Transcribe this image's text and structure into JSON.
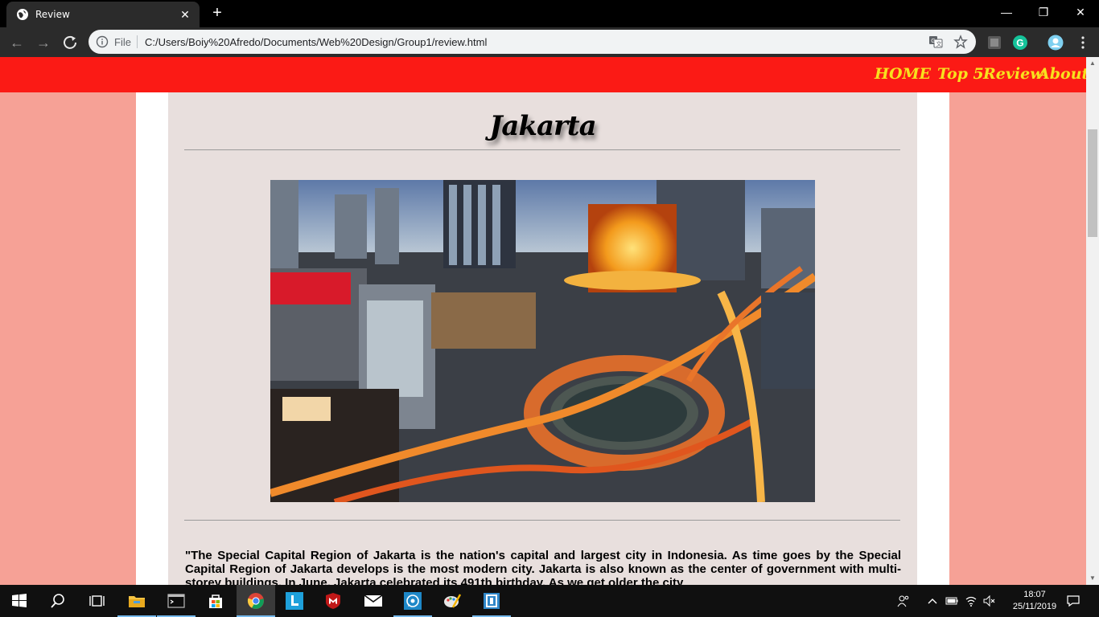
{
  "browser": {
    "tab_title": "Review",
    "tab_close": "✕",
    "new_tab": "+",
    "window_controls": {
      "minimize": "—",
      "restore": "❐",
      "close": "✕"
    },
    "url_scheme_label": "File",
    "url": "C:/Users/Boiy%20Afredo/Documents/Web%20Design/Group1/review.html"
  },
  "site": {
    "nav": [
      "HOME",
      "Top 5",
      "Review",
      "About Us"
    ],
    "nav_color": "#fb1a15",
    "nav_text_color": "#f7e11e",
    "background_color": "#f6a196",
    "content_color": "#e8dfdd"
  },
  "page": {
    "heading": "Jakarta",
    "paragraph": "\"The Special Capital Region of Jakarta is the nation's capital and largest city in Indonesia. As time goes by the Special Capital Region of Jakarta develops is the most modern city. Jakarta is also known as the center of government with multi-storey buildings. In June, Jakarta celebrated its 491th birthday. As we get older the city"
  },
  "taskbar": {
    "apps": [
      "start-icon",
      "search-icon",
      "task-view-icon",
      "file-explorer-icon",
      "terminal-icon",
      "store-icon",
      "chrome-icon",
      "l-app-icon",
      "mcafee-icon",
      "mail-icon",
      "whatsapp-icon",
      "paint-icon",
      "frame-app-icon"
    ],
    "time": "18:07",
    "date": "25/11/2019"
  }
}
